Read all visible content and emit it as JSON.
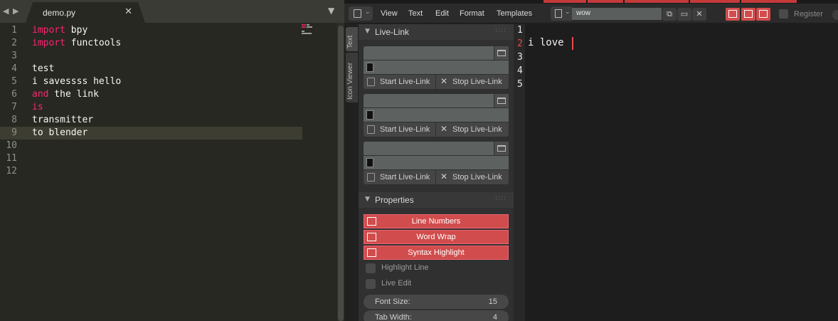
{
  "sublime": {
    "nav_left": "◀",
    "nav_right": "▶",
    "tab": {
      "filename": "demo.py",
      "close": "✕"
    },
    "dropdown": "▼",
    "line_numbers": [
      "1",
      "2",
      "3",
      "4",
      "5",
      "6",
      "7",
      "8",
      "9",
      "10",
      "11",
      "12"
    ],
    "current_line": 9,
    "lines": [
      {
        "kw": "import",
        "rest": " bpy"
      },
      {
        "kw": "import",
        "rest": " functools"
      },
      {
        "kw": "",
        "rest": ""
      },
      {
        "kw": "",
        "rest": "test"
      },
      {
        "kw": "",
        "rest": "i savessss hello"
      },
      {
        "kw": "and",
        "rest": " the link"
      },
      {
        "kw": "is",
        "rest": ""
      },
      {
        "kw": "",
        "rest": "transmitter"
      },
      {
        "kw": "",
        "rest": "to blender"
      }
    ]
  },
  "blender": {
    "menu": [
      "View",
      "Text",
      "Edit",
      "Format",
      "Templates"
    ],
    "text_block_name": "wow",
    "register_label": "Register",
    "side_tabs": [
      "Text",
      "Icon Viewer"
    ],
    "live_link": {
      "title": "Live-Link",
      "grip": "::::",
      "start_label": "Start Live-Link",
      "stop_label": "Stop Live-Link",
      "stop_icon": "✕",
      "entries": 3
    },
    "properties": {
      "title": "Properties",
      "toggles": [
        "Line Numbers",
        "Word Wrap",
        "Syntax Highlight"
      ],
      "checks": [
        "Highlight Line",
        "Live Edit"
      ],
      "font_size_label": "Font Size:",
      "font_size": "15",
      "tab_width_label": "Tab Width:",
      "tab_width": "4"
    },
    "editor": {
      "line_numbers": [
        "1",
        "2",
        "3",
        "4",
        "5"
      ],
      "current_line": 2,
      "line2_text": "i love "
    },
    "colors": {
      "accent_red": "#d14c4c",
      "keyword": "#f92672"
    }
  }
}
